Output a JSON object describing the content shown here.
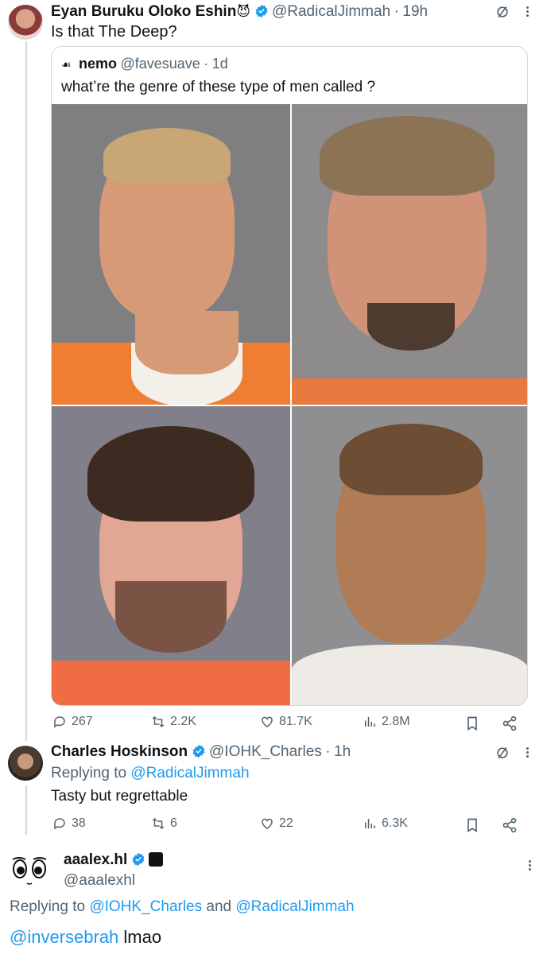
{
  "tweet1": {
    "name": "Eyan Buruku Oloko Eshin",
    "name_emoji": "😈",
    "handle": "@RadicalJimmah",
    "time": "19h",
    "text": "Is that The Deep?",
    "quote": {
      "name": "nemo",
      "handle": "@favesuave",
      "time": "1d",
      "text": "what’re the genre of these type of men called ?"
    },
    "actions": {
      "replies": "267",
      "retweets": "2.2K",
      "likes": "81.7K",
      "views": "2.8M"
    }
  },
  "tweet2": {
    "name": "Charles Hoskinson",
    "handle": "@IOHK_Charles",
    "time": "1h",
    "replying_prefix": "Replying to ",
    "replying_to": "@RadicalJimmah",
    "text": "Tasty but regrettable",
    "actions": {
      "replies": "38",
      "retweets": "6",
      "likes": "22",
      "views": "6.3K"
    }
  },
  "tweet3": {
    "name": "aaalex.hl",
    "handle": "@aaalexhl",
    "replying_prefix": "Replying to ",
    "replying_to_1": "@IOHK_Charles",
    "replying_and": " and ",
    "replying_to_2": "@RadicalJimmah",
    "mention": "@inversebrah",
    "text": " lmao"
  },
  "separator": "·",
  "icons": {
    "grok": "grok-slash-icon",
    "more": "more-icon",
    "reply": "reply-icon",
    "retweet": "retweet-icon",
    "like": "heart-icon",
    "views": "views-icon",
    "bookmark": "bookmark-icon",
    "share": "share-icon",
    "verified": "verified-badge-icon"
  },
  "colors": {
    "verified": "#1d9bf0",
    "link": "#1d9bf0",
    "muted": "#536471",
    "border": "#cfd9de"
  }
}
